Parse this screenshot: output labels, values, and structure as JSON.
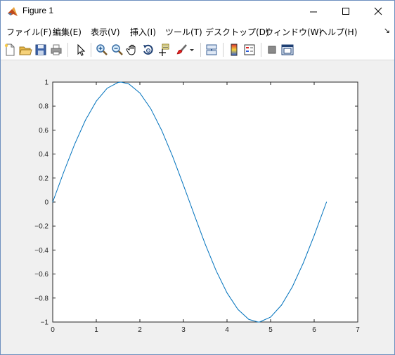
{
  "window": {
    "title": "Figure 1",
    "controls": [
      "minimize-icon",
      "maximize-icon",
      "close-icon"
    ]
  },
  "menubar": {
    "items": [
      "ファイル(F)",
      "編集(E)",
      "表示(V)",
      "挿入(I)",
      "ツール(T)",
      "デスクトップ(D)",
      "ウィンドウ(W)",
      "ヘルプ(H)"
    ],
    "corner_glyph": "↘"
  },
  "toolbar": {
    "icons": [
      "new-figure-icon",
      "open-file-icon",
      "save-icon",
      "print-icon",
      "edit-plot-pointer-icon",
      "zoom-in-icon",
      "zoom-out-icon",
      "pan-hand-icon",
      "rotate-3d-icon",
      "data-cursor-icon",
      "brush-icon",
      "brush-dropdown-icon",
      "link-plot-icon",
      "colorbar-icon",
      "legend-icon",
      "hide-plot-tools-icon",
      "show-plot-tools-icon"
    ]
  },
  "colors": {
    "line": "#0072bd",
    "axes": "#262626",
    "figure_bg": "#f0f0f0",
    "axes_bg": "#ffffff"
  },
  "chart_data": {
    "type": "line",
    "title": "",
    "xlabel": "",
    "ylabel": "",
    "xlim": [
      0,
      7
    ],
    "ylim": [
      -1,
      1
    ],
    "xticks": [
      "0",
      "1",
      "2",
      "3",
      "4",
      "5",
      "6",
      "7"
    ],
    "yticks": [
      "1",
      "0.8",
      "0.6",
      "0.4",
      "0.2",
      "0",
      "−0.2",
      "−0.4",
      "−0.6",
      "−0.8",
      "−1"
    ],
    "grid": false,
    "x": [
      0,
      0.25,
      0.5,
      0.75,
      1.0,
      1.25,
      1.5,
      1.571,
      1.75,
      2.0,
      2.25,
      2.5,
      2.75,
      3.0,
      3.142,
      3.25,
      3.5,
      3.75,
      4.0,
      4.25,
      4.5,
      4.712,
      4.75,
      5.0,
      5.25,
      5.5,
      5.75,
      6.0,
      6.283
    ],
    "y": [
      0,
      0.247,
      0.479,
      0.682,
      0.841,
      0.949,
      0.997,
      1.0,
      0.984,
      0.909,
      0.778,
      0.598,
      0.382,
      0.141,
      0,
      -0.108,
      -0.351,
      -0.572,
      -0.757,
      -0.895,
      -0.978,
      -1.0,
      -0.999,
      -0.959,
      -0.859,
      -0.706,
      -0.508,
      -0.279,
      0
    ]
  }
}
